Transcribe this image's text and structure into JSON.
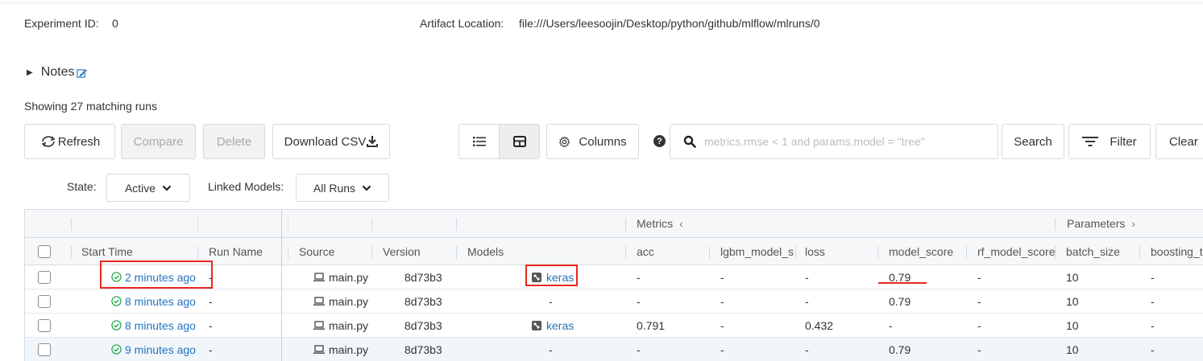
{
  "experiment": {
    "id_label": "Experiment ID",
    "id_value": "0",
    "artifact_label": "Artifact Location",
    "artifact_value": "file:///Users/leesoojin/Desktop/python/github/mlflow/mlruns/0"
  },
  "notes": {
    "label": "Notes"
  },
  "showing_text": "Showing 27 matching runs",
  "toolbar": {
    "refresh": "Refresh",
    "compare": "Compare",
    "delete": "Delete",
    "download_csv": "Download CSV",
    "columns": "Columns",
    "search_placeholder": "metrics.rmse < 1 and params.model = \"tree\"",
    "search_value": "",
    "search_button": "Search",
    "filter": "Filter",
    "clear": "Clear"
  },
  "filters": {
    "state_label": "State:",
    "state_value": "Active",
    "linked_models_label": "Linked Models:",
    "linked_models_value": "All Runs"
  },
  "table": {
    "group_headers": {
      "metrics": "Metrics",
      "parameters": "Parameters"
    },
    "columns": [
      "Start Time",
      "Run Name",
      "Source",
      "Version",
      "Models",
      "acc",
      "lgbm_model_s",
      "loss",
      "model_score",
      "rf_model_score",
      "batch_size",
      "boosting_t"
    ],
    "rows": [
      {
        "start_time": "2 minutes ago",
        "run_name": "-",
        "source": "main.py",
        "version": "8d73b3",
        "models": "keras",
        "acc": "-",
        "lgbm": "-",
        "loss": "-",
        "model_score": "0.79",
        "rf_model_score": "-",
        "batch_size": "10",
        "boosting": "-"
      },
      {
        "start_time": "8 minutes ago",
        "run_name": "-",
        "source": "main.py",
        "version": "8d73b3",
        "models": "-",
        "acc": "-",
        "lgbm": "-",
        "loss": "-",
        "model_score": "0.79",
        "rf_model_score": "-",
        "batch_size": "10",
        "boosting": "-"
      },
      {
        "start_time": "8 minutes ago",
        "run_name": "-",
        "source": "main.py",
        "version": "8d73b3",
        "models": "keras",
        "acc": "0.791",
        "lgbm": "-",
        "loss": "0.432",
        "model_score": "-",
        "rf_model_score": "-",
        "batch_size": "10",
        "boosting": "-"
      },
      {
        "start_time": "9 minutes ago",
        "run_name": "-",
        "source": "main.py",
        "version": "8d73b3",
        "models": "-",
        "acc": "-",
        "lgbm": "-",
        "loss": "-",
        "model_score": "0.79",
        "rf_model_score": "-",
        "batch_size": "10",
        "boosting": "-"
      }
    ]
  },
  "colors": {
    "link": "#2374bb",
    "success": "#22a34a",
    "annotation": "#e8271c",
    "header_bg": "#f5f7f9"
  }
}
